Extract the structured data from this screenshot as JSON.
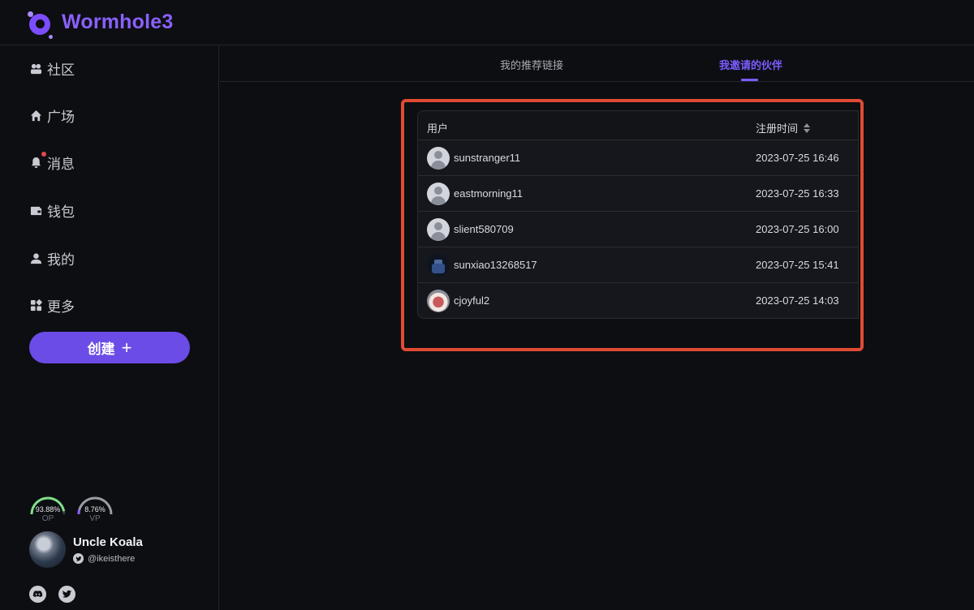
{
  "app": {
    "name": "Wormhole3"
  },
  "sidebar": {
    "items": [
      {
        "label": "社区",
        "icon": "community-icon"
      },
      {
        "label": "广场",
        "icon": "home-icon"
      },
      {
        "label": "消息",
        "icon": "bell-icon",
        "has_unread_dot": true
      },
      {
        "label": "钱包",
        "icon": "wallet-icon"
      },
      {
        "label": "我的",
        "icon": "user-icon"
      },
      {
        "label": "更多",
        "icon": "grid-icon"
      }
    ],
    "create_label": "创建",
    "create_icon": "plus-icon"
  },
  "gauges": [
    {
      "value": "93.88%",
      "label": "OP",
      "fraction": 0.9388,
      "color": "#7fe08a"
    },
    {
      "value": "8.76%",
      "label": "VP",
      "fraction": 0.0876,
      "color": "#8a5cff"
    }
  ],
  "profile": {
    "name": "Uncle Koala",
    "handle": "@ikeisthere"
  },
  "social": [
    "discord-icon",
    "twitter-icon"
  ],
  "tabs": [
    {
      "label": "我的推荐链接",
      "active": false
    },
    {
      "label": "我邀请的伙伴",
      "active": true
    }
  ],
  "table": {
    "columns": {
      "user": "用户",
      "time": "注册时间"
    },
    "rows": [
      {
        "user": "sunstranger11",
        "time": "2023-07-25 16:46",
        "avatar": "default"
      },
      {
        "user": "eastmorning11",
        "time": "2023-07-25 16:33",
        "avatar": "default"
      },
      {
        "user": "slient580709",
        "time": "2023-07-25 16:00",
        "avatar": "default"
      },
      {
        "user": "sunxiao13268517",
        "time": "2023-07-25 15:41",
        "avatar": "dark"
      },
      {
        "user": "cjoyful2",
        "time": "2023-07-25 14:03",
        "avatar": "cake"
      }
    ]
  },
  "colors": {
    "accent": "#6b4ce6",
    "highlight_border": "#e04b33",
    "background": "#0d0e12"
  }
}
